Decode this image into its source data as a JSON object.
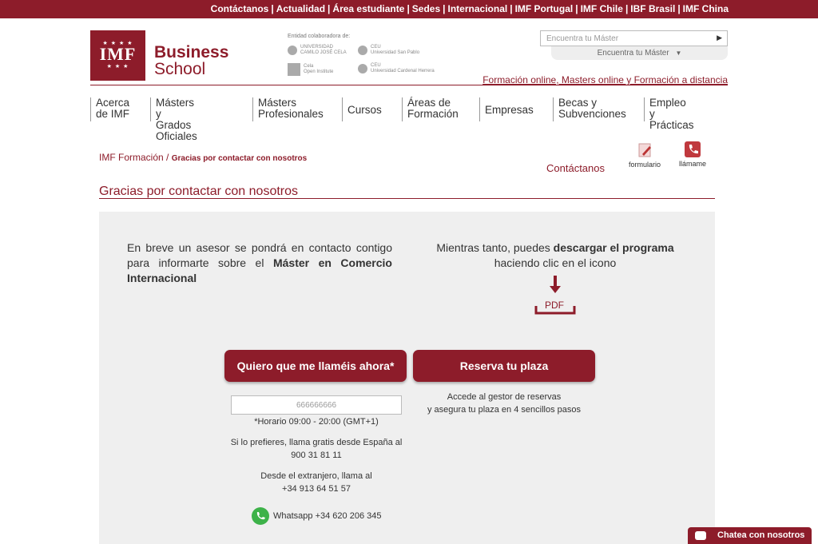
{
  "topbar": {
    "links": [
      "Contáctanos",
      "Actualidad",
      "Área estudiante",
      "Sedes",
      "Internacional",
      "IMF Portugal",
      "IMF Chile",
      "IBF Brasil",
      "IMF China"
    ]
  },
  "logo": {
    "stars_top": "★ ★ ★ ★",
    "text": "IMF",
    "stars_bottom": "★ ★ ★"
  },
  "brand": {
    "line1": "Business",
    "line2": "School"
  },
  "collab": {
    "title": "Entidad colaboradora de:",
    "entities": [
      {
        "line1": "UNIVERSIDAD",
        "line2": "CAMILO JOSÉ CELA"
      },
      {
        "line1": "CEU",
        "line2": "Universidad San Pablo"
      },
      {
        "line1": "Cela",
        "line2": "Open Institute"
      },
      {
        "line1": "CEU",
        "line2": "Universidad Cardenal Herrera"
      }
    ]
  },
  "search": {
    "placeholder": "Encuentra tu Máster",
    "go_glyph": "▶",
    "dropdown_label": "Encuentra tu Máster",
    "dropdown_arrow": "▼"
  },
  "tagline": "Formación online, Masters online y Formación a distancia",
  "nav": {
    "items": [
      {
        "l1": "Acerca",
        "l2": "de IMF"
      },
      {
        "l1": "Másters y",
        "l2": "Grados Oficiales"
      },
      {
        "l1": "Másters",
        "l2": "Profesionales"
      },
      {
        "l1": "Cursos",
        "l2": ""
      },
      {
        "l1": "Áreas de",
        "l2": "Formación"
      },
      {
        "l1": "Empresas",
        "l2": ""
      },
      {
        "l1": "Becas y",
        "l2": "Subvenciones"
      },
      {
        "l1": "Empleo y",
        "l2": "Prácticas"
      }
    ]
  },
  "breadcrumb": {
    "home": "IMF Formación",
    "sep": "/",
    "current": "Gracias por contactar con nosotros"
  },
  "contact_actions": {
    "label": "Contáctanos",
    "form": "formulario",
    "call": "llámame"
  },
  "page_title": "Gracias por contactar con nosotros",
  "left_text": {
    "part1": "En breve un asesor se pondrá en contacto contigo para informarte sobre el ",
    "bold": "Máster en Comercio Internacional"
  },
  "right_text": {
    "part1": "Mientras tanto, puedes ",
    "bold": "descargar el programa",
    "part2": "haciendo clic en el icono"
  },
  "pdf_label": "PDF",
  "buttons": {
    "call_now": "Quiero que me llaméis ahora*",
    "reserve": "Reserva tu plaza"
  },
  "phone_value": "666666666",
  "schedule": "*Horario 09:00 - 20:00 (GMT+1)",
  "spain_call": {
    "line1": "Si lo prefieres, llama gratis desde España al",
    "line2": "900 31 81 11"
  },
  "abroad_call": {
    "line1": "Desde el extranjero, llama al",
    "line2": "+34 913 64 51 57"
  },
  "whatsapp": "Whatsapp +34 620 206 345",
  "reserve_text": {
    "line1": "Accede al gestor de reservas",
    "line2": "y asegura tu plaza en 4 sencillos pasos"
  },
  "chat_label": "Chatea con nosotros",
  "colors": {
    "brand": "#8d1c2a",
    "panel": "#efefef",
    "whatsapp": "#3db249"
  }
}
